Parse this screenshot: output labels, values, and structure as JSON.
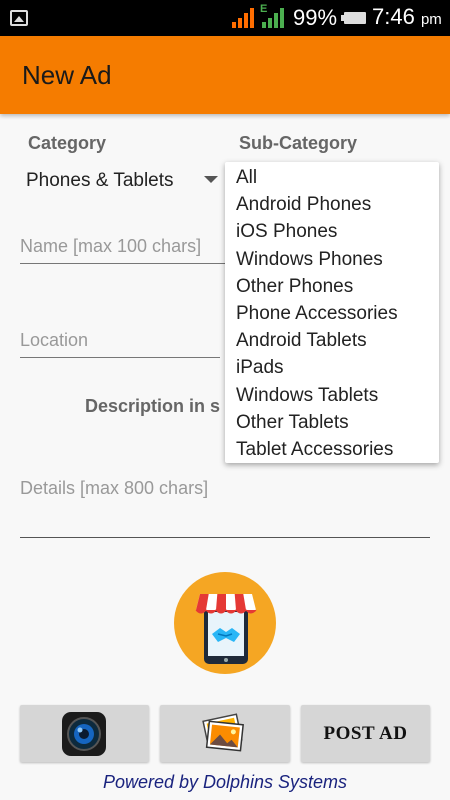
{
  "status_bar": {
    "network_type": "E",
    "battery": "99%",
    "time": "7:46",
    "time_suffix": "pm"
  },
  "app_bar": {
    "title": "New Ad"
  },
  "form": {
    "category_label": "Category",
    "subcategory_label": "Sub-Category",
    "category_value": "Phones & Tablets",
    "name_placeholder": "Name [max 100 chars]",
    "location_placeholder": "Location",
    "description_heading": "Description in s",
    "details_placeholder": "Details [max 800 chars]"
  },
  "subcategory_dropdown": {
    "options": [
      "All",
      "Android Phones",
      "iOS Phones",
      "Windows Phones",
      "Other Phones",
      "Phone Accessories",
      "Android Tablets",
      "iPads",
      "Windows Tablets",
      "Other Tablets",
      "Tablet Accessories"
    ]
  },
  "buttons": {
    "camera_icon": "camera-icon",
    "gallery_icon": "photo-gallery-icon",
    "post_label": "POST AD"
  },
  "footer": {
    "text": "Powered by Dolphins Systems"
  },
  "colors": {
    "app_bar": "#f57c00",
    "logo_bg": "#f5a623",
    "footer_text": "#1a237e"
  }
}
